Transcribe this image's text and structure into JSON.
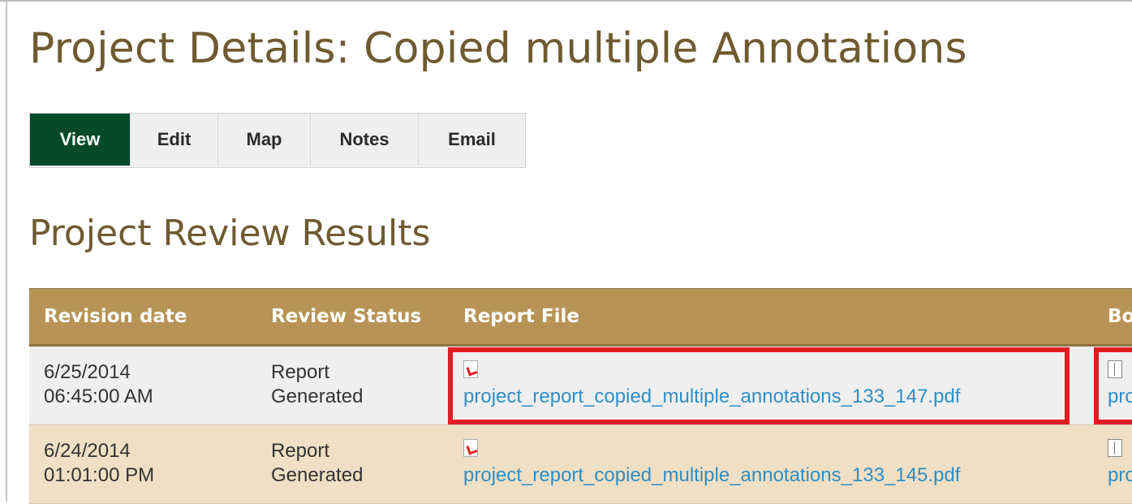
{
  "page": {
    "title": "Project Details: Copied multiple Annotations"
  },
  "tabs": [
    {
      "label": "View",
      "active": true
    },
    {
      "label": "Edit",
      "active": false
    },
    {
      "label": "Map",
      "active": false
    },
    {
      "label": "Notes",
      "active": false
    },
    {
      "label": "Email",
      "active": false
    }
  ],
  "section": {
    "title": "Project Review Results"
  },
  "table": {
    "headers": [
      "Revision date",
      "Review Status",
      "Report File",
      "Bo"
    ],
    "rows": [
      {
        "date": "6/25/2014",
        "time": "06:45:00 AM",
        "status_line1": "Report",
        "status_line2": "Generated",
        "file_icon": "pdf-icon",
        "file": "project_report_copied_multiple_annotations_133_147.pdf",
        "extra_icon": "document-icon",
        "extra": "pro"
      },
      {
        "date": "6/24/2014",
        "time": "01:01:00 PM",
        "status_line1": "Report",
        "status_line2": "Generated",
        "file_icon": "pdf-icon",
        "file": "project_report_copied_multiple_annotations_133_145.pdf",
        "extra_icon": "document-icon",
        "extra": "pro"
      }
    ]
  },
  "colors": {
    "title": "#6f5a30",
    "active_tab": "#064a2c",
    "table_header": "#b79456",
    "link": "#2e8fc7",
    "highlight": "#e31c23"
  }
}
